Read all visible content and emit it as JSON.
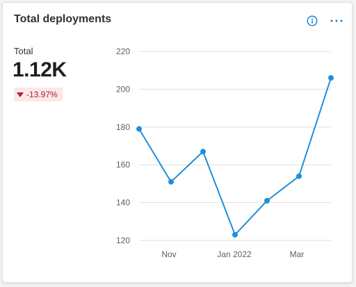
{
  "card": {
    "title": "Total deployments",
    "info_icon": "info-icon",
    "more_icon": "more-icon"
  },
  "kpi": {
    "label": "Total",
    "value": "1.12K",
    "delta": "-13.97%",
    "delta_direction": "down",
    "delta_icon": "triangle-down-icon",
    "delta_color": "#a4262c",
    "delta_bg": "#fde7e9"
  },
  "chart_data": {
    "type": "line",
    "series": [
      {
        "values": [
          179,
          151,
          167,
          123,
          141,
          154,
          206
        ]
      }
    ],
    "x_tick_labels": [
      "Nov",
      "Jan 2022",
      "Mar"
    ],
    "y_ticks": [
      120,
      140,
      160,
      180,
      200,
      220
    ],
    "ylim": [
      120,
      220
    ],
    "grid": true,
    "legend": "none",
    "line_color": "#1e8fd9"
  }
}
